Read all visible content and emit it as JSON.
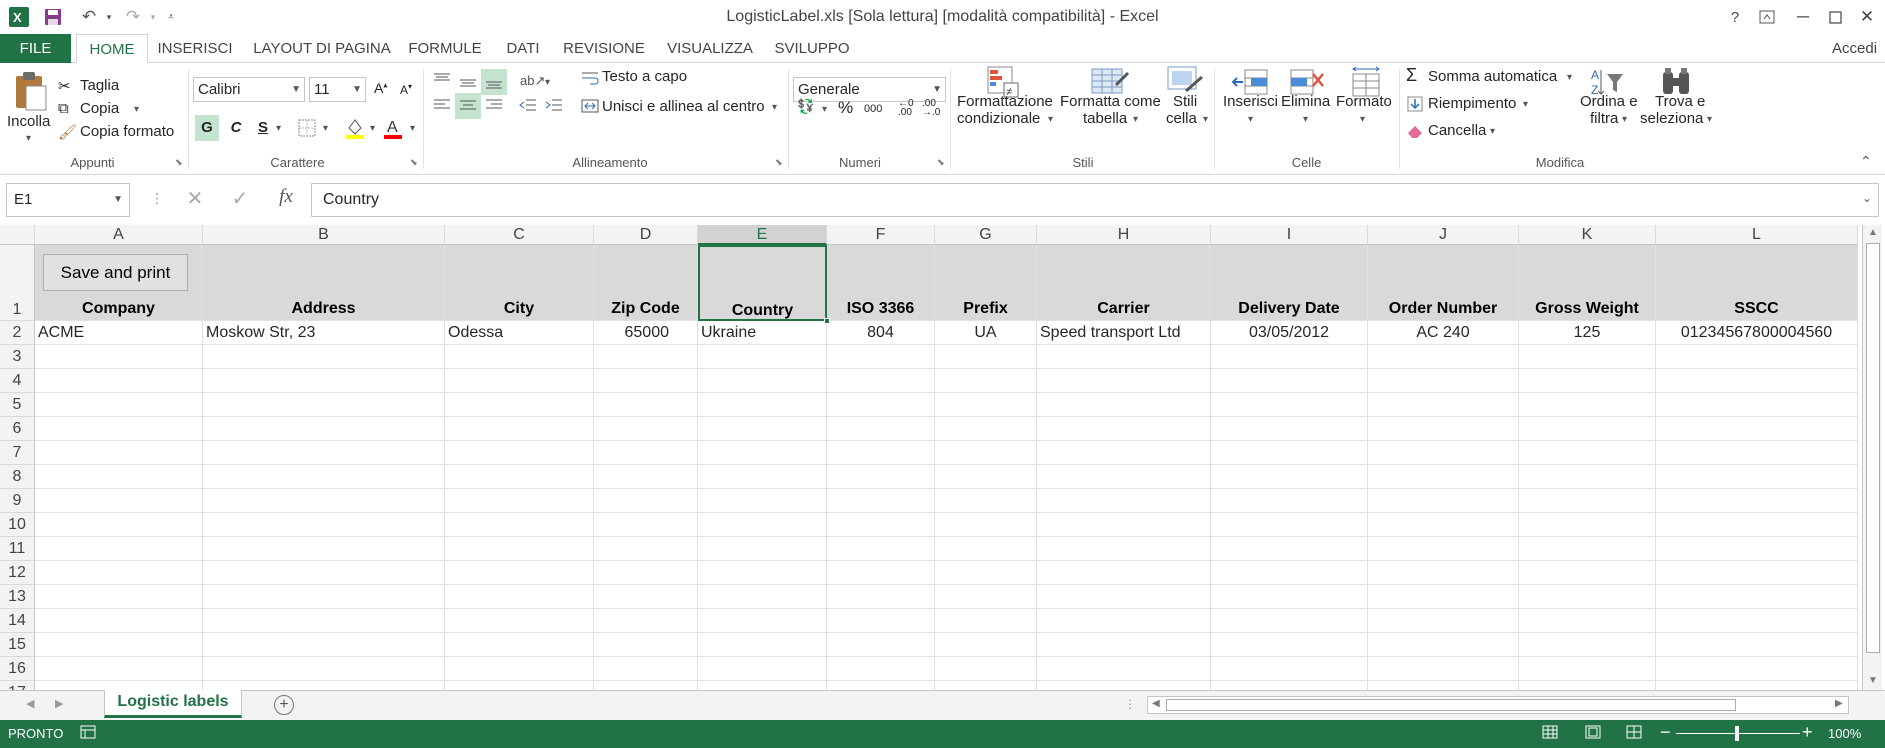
{
  "window": {
    "title": "LogisticLabel.xls  [Sola lettura]  [modalità compatibilità] - Excel",
    "help": "?",
    "signin": "Accedi"
  },
  "colors": {
    "accent": "#217346",
    "header_fill": "#d9d9d9",
    "selection": "#c5e4cf"
  },
  "tabs": [
    "FILE",
    "HOME",
    "INSERISCI",
    "LAYOUT DI PAGINA",
    "FORMULE",
    "DATI",
    "REVISIONE",
    "VISUALIZZA",
    "SVILUPPO"
  ],
  "ribbon": {
    "clipboard": {
      "paste": "Incolla",
      "cut": "Taglia",
      "copy": "Copia",
      "format_painter": "Copia formato",
      "group": "Appunti"
    },
    "font": {
      "name": "Calibri",
      "size": "11",
      "bold": "G",
      "italic": "C",
      "underline": "S",
      "group": "Carattere"
    },
    "alignment": {
      "wrap": "Testo a capo",
      "merge": "Unisci e allinea al centro",
      "group": "Allineamento"
    },
    "number": {
      "format": "Generale",
      "percent": "%",
      "thousands": "000",
      "group": "Numeri"
    },
    "styles": {
      "cond_line1": "Formattazione",
      "cond_line2": "condizionale",
      "table_line1": "Formatta come",
      "table_line2": "tabella",
      "cell_line1": "Stili",
      "cell_line2": "cella",
      "group": "Stili"
    },
    "cells": {
      "insert": "Inserisci",
      "delete": "Elimina",
      "format": "Formato",
      "group": "Celle"
    },
    "editing": {
      "autosum": "Somma automatica",
      "fill": "Riempimento",
      "clear": "Cancella",
      "sort_line1": "Ordina e",
      "sort_line2": "filtra",
      "find_line1": "Trova e",
      "find_line2": "seleziona",
      "group": "Modifica"
    }
  },
  "formula_bar": {
    "name_box": "E1",
    "fx": "fx",
    "value": "Country"
  },
  "sheet": {
    "columns": [
      "A",
      "B",
      "C",
      "D",
      "E",
      "F",
      "G",
      "H",
      "I",
      "J",
      "K",
      "L"
    ],
    "rows": [
      "1",
      "2",
      "3",
      "4",
      "5",
      "6",
      "7",
      "8",
      "9",
      "10",
      "11",
      "12",
      "13",
      "14",
      "15",
      "16",
      "17"
    ],
    "button": "Save and print",
    "headers": [
      "Company",
      "Address",
      "City",
      "Zip Code",
      "Country",
      "ISO 3366",
      "Prefix",
      "Carrier",
      "Delivery Date",
      "Order Number",
      "Gross Weight",
      "SSCC"
    ],
    "data": [
      [
        "ACME",
        "Moskow Str, 23",
        "Odessa",
        "65000",
        "Ukraine",
        "804",
        "UA",
        "Speed transport Ltd",
        "03/05/2012",
        "AC 240",
        "125",
        "01234567800004560"
      ]
    ],
    "selected": "E1"
  },
  "sheet_tabs": [
    "Logistic labels"
  ],
  "status": {
    "mode": "PRONTO",
    "zoom": "100%"
  }
}
